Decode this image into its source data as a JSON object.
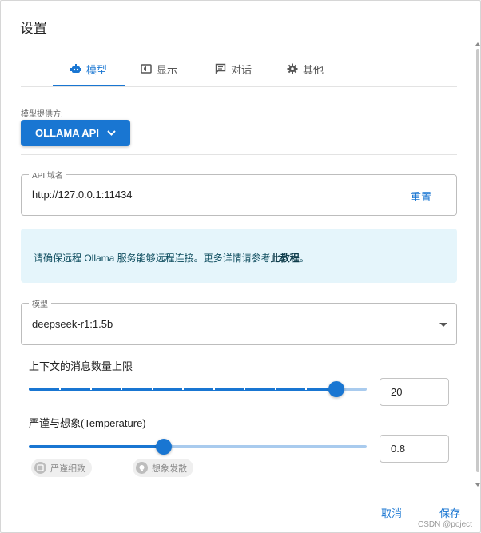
{
  "dialog": {
    "title": "设置"
  },
  "tabs": [
    {
      "label": "模型",
      "icon": "robot-icon",
      "active": true
    },
    {
      "label": "显示",
      "icon": "display-icon",
      "active": false
    },
    {
      "label": "对话",
      "icon": "chat-icon",
      "active": false
    },
    {
      "label": "其他",
      "icon": "gear-icon",
      "active": false
    }
  ],
  "provider": {
    "label": "模型提供方:",
    "value": "OLLAMA API"
  },
  "api_host": {
    "label": "API 域名",
    "value": "http://127.0.0.1:11434",
    "reset_label": "重置"
  },
  "info": {
    "text": "请确保远程 Ollama 服务能够远程连接。更多详情请参考",
    "link": "此教程",
    "suffix": "。"
  },
  "model": {
    "label": "模型",
    "value": "deepseek-r1:1.5b"
  },
  "context_limit": {
    "label": "上下文的消息数量上限",
    "value": "20",
    "slider_fraction": 0.91
  },
  "temperature": {
    "label": "严谨与想象(Temperature)",
    "value": "0.8",
    "slider_fraction": 0.4,
    "chip_left": "严谨细致",
    "chip_right": "想象发散"
  },
  "footer": {
    "cancel": "取消",
    "save": "保存"
  },
  "watermark": "CSDN @poject",
  "colors": {
    "accent": "#1976d2",
    "info_bg": "#e5f5fb"
  }
}
